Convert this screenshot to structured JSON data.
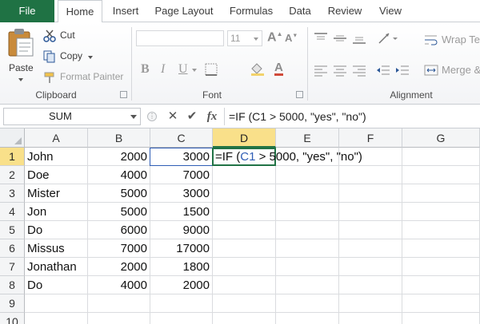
{
  "tabs": [
    "File",
    "Home",
    "Insert",
    "Page Layout",
    "Formulas",
    "Data",
    "Review",
    "View"
  ],
  "ribbon": {
    "clipboard": {
      "paste": "Paste",
      "cut": "Cut",
      "copy": "Copy",
      "format_painter": "Format Painter",
      "label": "Clipboard"
    },
    "font": {
      "font_size": "11",
      "bold": "B",
      "italic": "I",
      "underline": "U",
      "label": "Font"
    },
    "alignment": {
      "wrap_text": "Wrap Te",
      "merge": "Merge &",
      "label": "Alignment"
    }
  },
  "formula_bar": {
    "name_box": "SUM",
    "fx": "fx",
    "formula": "=IF (C1 > 5000, \"yes\", \"no\")"
  },
  "grid": {
    "columns": [
      "A",
      "B",
      "C",
      "D",
      "E",
      "F",
      "G"
    ],
    "rows": [
      "1",
      "2",
      "3",
      "4",
      "5",
      "6",
      "7",
      "8",
      "9",
      "10"
    ],
    "data": [
      [
        "John",
        "2000",
        "3000"
      ],
      [
        "Doe",
        "4000",
        "7000"
      ],
      [
        "Mister",
        "5000",
        "3000"
      ],
      [
        "Jon",
        "5000",
        "1500"
      ],
      [
        "Do",
        "6000",
        "9000"
      ],
      [
        "Missus",
        "7000",
        "17000"
      ],
      [
        "Jonathan",
        "2000",
        "1800"
      ],
      [
        "Do",
        "4000",
        "2000"
      ]
    ],
    "editing": {
      "prefix": "=IF (",
      "ref": "C1",
      "suffix": " > 5000, \"yes\", \"no\")"
    }
  },
  "colors": {
    "file_tab": "#1f7244",
    "active_header": "#f9e08a",
    "selection": "#217346",
    "ref_color": "#2f5db5"
  }
}
